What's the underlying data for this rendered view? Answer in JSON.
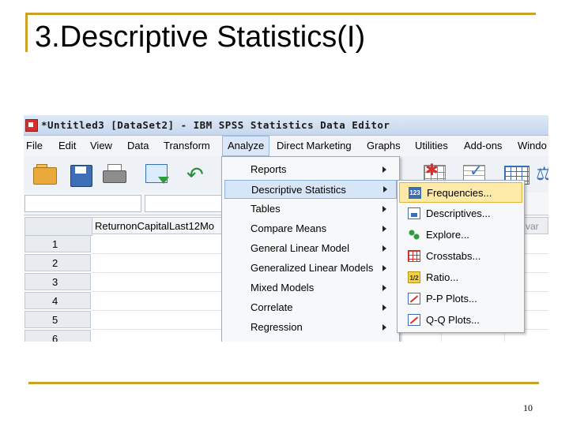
{
  "slide": {
    "title": "3.Descriptive Statistics(I)",
    "page_number": "10"
  },
  "app": {
    "window_title": "*Untitled3 [DataSet2] - IBM SPSS Statistics Data Editor",
    "menu": [
      "File",
      "Edit",
      "View",
      "Data",
      "Transform",
      "Analyze",
      "Direct Marketing",
      "Graphs",
      "Utilities",
      "Add-ons",
      "Windo"
    ],
    "active_menu": "Analyze",
    "grid": {
      "column_header": "ReturnonCapitalLast12Mo",
      "right_column_header": "var",
      "row_numbers": [
        "1",
        "2",
        "3",
        "4",
        "5",
        "6"
      ]
    },
    "analyze_menu": [
      {
        "label": "Reports",
        "has_submenu": true
      },
      {
        "label": "Descriptive Statistics",
        "has_submenu": true,
        "highlighted": true
      },
      {
        "label": "Tables",
        "has_submenu": true
      },
      {
        "label": "Compare Means",
        "has_submenu": true
      },
      {
        "label": "General Linear Model",
        "has_submenu": true
      },
      {
        "label": "Generalized Linear Models",
        "has_submenu": true
      },
      {
        "label": "Mixed Models",
        "has_submenu": true
      },
      {
        "label": "Correlate",
        "has_submenu": true
      },
      {
        "label": "Regression",
        "has_submenu": true
      }
    ],
    "descriptive_submenu": [
      {
        "label": "Frequencies...",
        "icon": "frequencies-icon",
        "icon_text": "123",
        "highlighted": true
      },
      {
        "label": "Descriptives...",
        "icon": "descriptives-icon"
      },
      {
        "label": "Explore...",
        "icon": "explore-icon"
      },
      {
        "label": "Crosstabs...",
        "icon": "crosstabs-icon"
      },
      {
        "label": "Ratio...",
        "icon": "ratio-icon",
        "icon_text": "1/2"
      },
      {
        "label": "P-P Plots...",
        "icon": "pp-plots-icon"
      },
      {
        "label": "Q-Q Plots...",
        "icon": "qq-plots-icon"
      }
    ],
    "colors": {
      "accent_rule": "#c9a227",
      "menu_highlight": "#d6e5f7",
      "submenu_highlight": "#fde9a8"
    }
  }
}
